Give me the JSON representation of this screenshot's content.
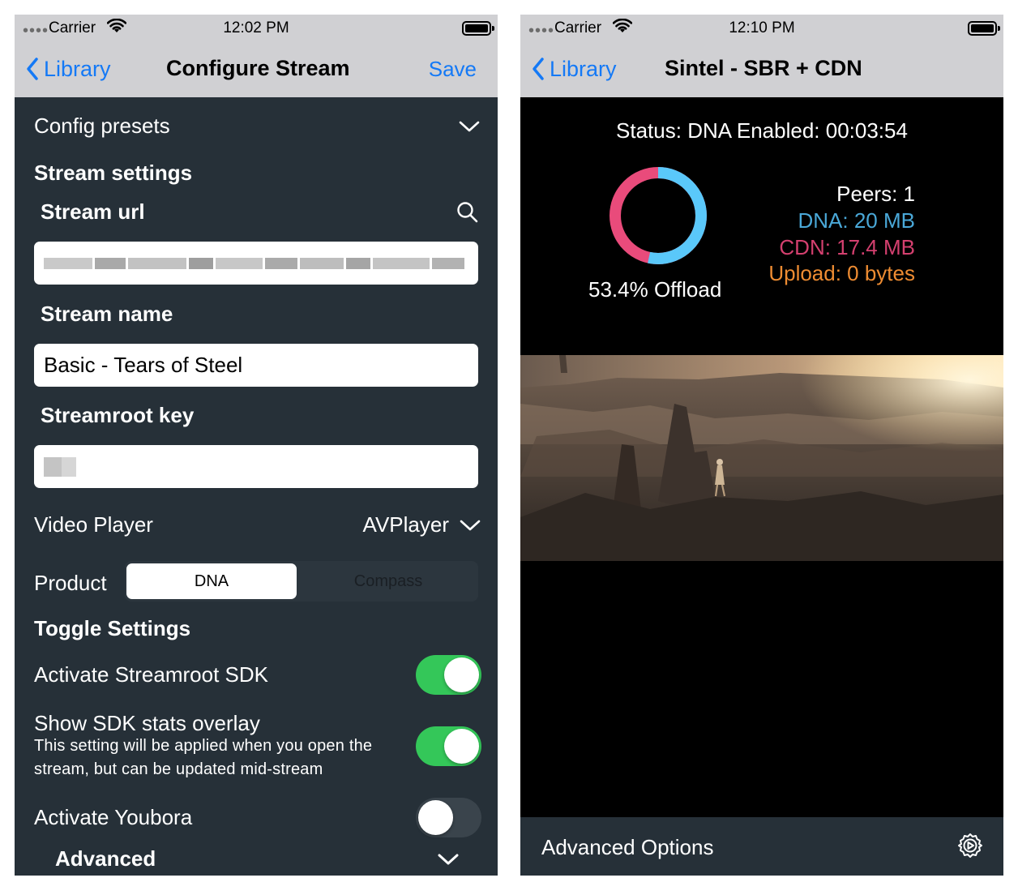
{
  "left_screen": {
    "status_bar": {
      "carrier": "Carrier",
      "time": "12:02 PM"
    },
    "nav": {
      "back_label": "Library",
      "title": "Configure Stream",
      "save_label": "Save"
    },
    "config_presets_label": "Config presets",
    "stream_settings_heading": "Stream settings",
    "stream_url": {
      "label": "Stream url",
      "value": ""
    },
    "stream_name": {
      "label": "Stream name",
      "value": "Basic - Tears of Steel"
    },
    "streamroot_key": {
      "label": "Streamroot key",
      "value": ""
    },
    "video_player": {
      "label": "Video Player",
      "value": "AVPlayer"
    },
    "product": {
      "label": "Product",
      "options": [
        "DNA",
        "Compass"
      ],
      "selected": "DNA"
    },
    "toggle_settings_heading": "Toggle Settings",
    "toggles": [
      {
        "label": "Activate Streamroot SDK",
        "on": true
      },
      {
        "label": "Show SDK stats overlay",
        "hint": "This setting will be applied when you open the stream, but can be updated mid-stream",
        "on": true
      },
      {
        "label": "Activate Youbora",
        "on": false
      }
    ],
    "advanced_label": "Advanced"
  },
  "right_screen": {
    "status_bar": {
      "carrier": "Carrier",
      "time": "12:10 PM"
    },
    "nav": {
      "back_label": "Library",
      "title": "Sintel - SBR + CDN"
    },
    "status_text": "Status: DNA Enabled: 00:03:54",
    "offload": {
      "label": "53.4% Offload",
      "fraction": 0.534
    },
    "stats": {
      "peers": "Peers: 1",
      "dna": "DNA: 20 MB",
      "cdn": "CDN: 17.4 MB",
      "upload": "Upload: 0 bytes"
    },
    "advanced_options_label": "Advanced Options"
  },
  "colors": {
    "accent_blue": "#1479f6",
    "toggle_on": "#34c759",
    "dna_stat": "#4aa8d8",
    "cdn_stat": "#d4406f",
    "upload_stat": "#ee8c32",
    "donut_dna": "#5ac8fa",
    "donut_cdn": "#e94b7b",
    "dark_background": "#263038"
  },
  "icons": [
    "wifi-icon",
    "battery-icon",
    "back-chevron-icon",
    "chevron-down-icon",
    "search-icon",
    "gear-icon"
  ]
}
